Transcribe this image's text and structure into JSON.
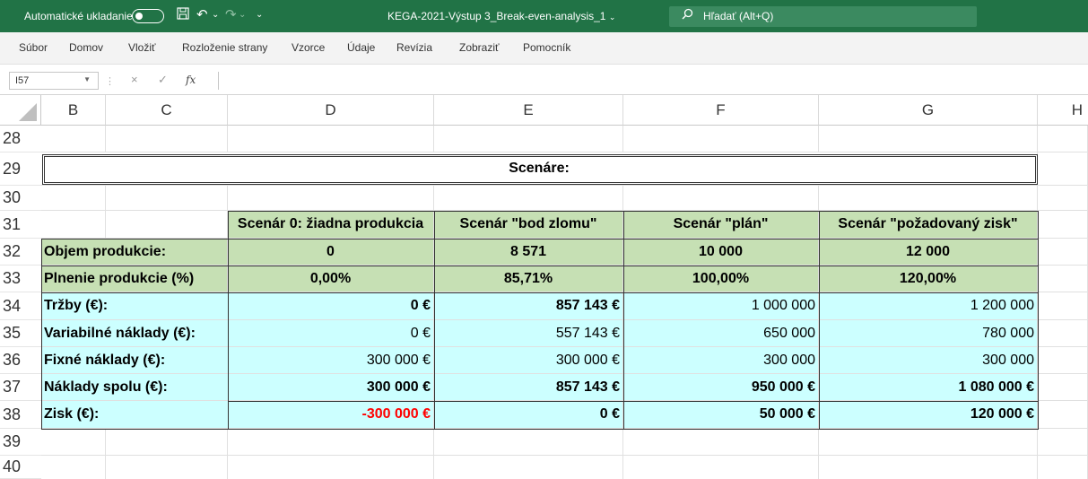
{
  "titlebar": {
    "autosave_label": "Automatické ukladanie",
    "doc_title": "KEGA-2021-Výstup 3_Break-even-analysis_1",
    "doc_title_chevron": "⌄",
    "search_placeholder": "Hľadať (Alt+Q)",
    "save_icon": "💾",
    "undo_icon": "↶",
    "redo_icon": "↷",
    "customize_icon": "⌄"
  },
  "ribbon": {
    "tabs": [
      "Súbor",
      "Domov",
      "Vložiť",
      "Rozloženie strany",
      "Vzorce",
      "Údaje",
      "Revízia",
      "Zobraziť",
      "Pomocník"
    ]
  },
  "formula_bar": {
    "name_box": "I57",
    "cancel": "×",
    "enter": "✓",
    "fx": "fx",
    "formula": ""
  },
  "columns": [
    "B",
    "C",
    "D",
    "E",
    "F",
    "G",
    "H"
  ],
  "rows": [
    "28",
    "29",
    "30",
    "31",
    "32",
    "33",
    "34",
    "35",
    "36",
    "37",
    "38",
    "39",
    "40"
  ],
  "sheet": {
    "title": "Scenáre:",
    "scenarios": [
      "Scenár 0: žiadna produkcia",
      "Scenár \"bod zlomu\"",
      "Scenár \"plán\"",
      "Scenár \"požadovaný zisk\""
    ],
    "labels": {
      "volume": "Objem produkcie:",
      "fulfilment": "Plnenie produkcie (%)",
      "revenue": "Tržby (€):",
      "variable": "Variabilné náklady (€):",
      "fixed": "Fixné náklady (€):",
      "total": "Náklady spolu (€):",
      "profit": "Zisk (€):"
    },
    "volume": [
      "0",
      "8 571",
      "10 000",
      "12 000"
    ],
    "fulfilment": [
      "0,00%",
      "85,71%",
      "100,00%",
      "120,00%"
    ],
    "revenue": [
      "0 €",
      "857 143 €",
      "1 000 000",
      "1 200 000"
    ],
    "variable": [
      "0 €",
      "557 143 €",
      "650 000",
      "780 000"
    ],
    "fixed": [
      "300 000 €",
      "300 000 €",
      "300 000",
      "300 000"
    ],
    "total": [
      "300 000 €",
      "857 143 €",
      "950 000 €",
      "1 080 000 €"
    ],
    "profit": [
      "-300 000 €",
      "0 €",
      "50 000 €",
      "120 000 €"
    ]
  }
}
